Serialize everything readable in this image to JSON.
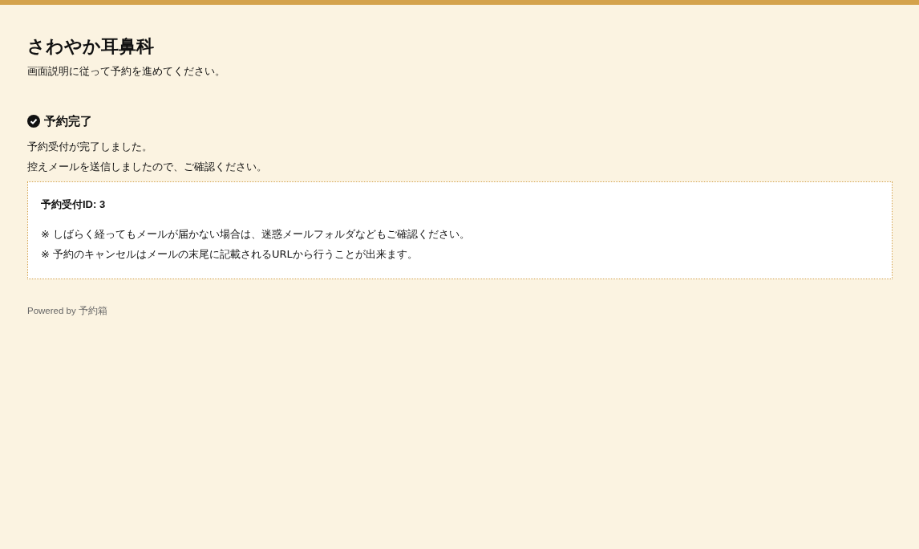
{
  "header": {
    "title": "さわやか耳鼻科",
    "subtitle": "画面説明に従って予約を進めてください。"
  },
  "section": {
    "title": "予約完了",
    "messages": [
      "予約受付が完了しました。",
      "控えメールを送信しましたので、ご確認ください。"
    ]
  },
  "info_box": {
    "id_label": "予約受付ID: 3",
    "notes": [
      "※ しばらく経ってもメールが届かない場合は、迷惑メールフォルダなどもご確認ください。",
      "※ 予約のキャンセルはメールの末尾に記載されるURLから行うことが出来ます。"
    ]
  },
  "footer": {
    "text": "Powered by 予約箱"
  }
}
